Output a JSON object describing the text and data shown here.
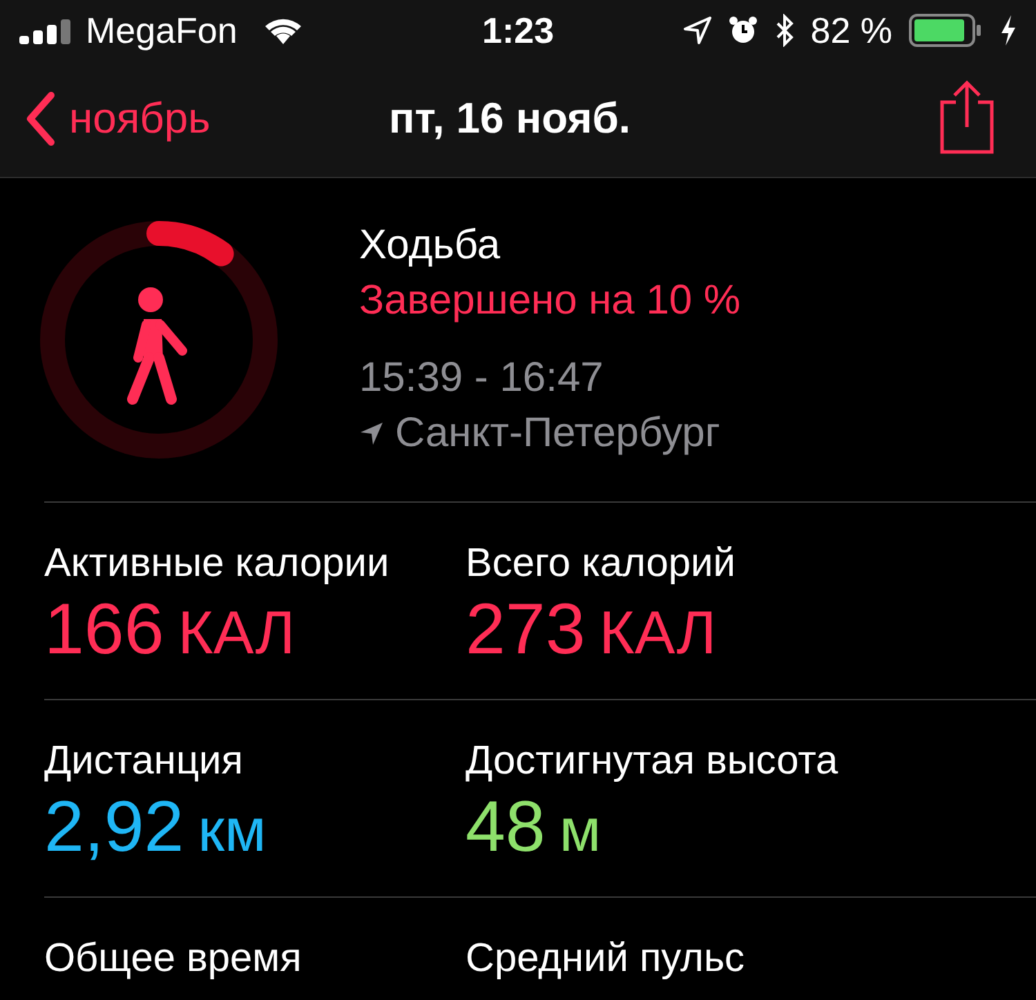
{
  "status_bar": {
    "carrier": "MegaFon",
    "time": "1:23",
    "battery": "82 %"
  },
  "nav": {
    "back": "ноябрь",
    "title": "пт, 16 нояб."
  },
  "workout": {
    "title": "Ходьба",
    "completion": "Завершено на 10 %",
    "time_range": "15:39 - 16:47",
    "location": "Санкт-Петербург",
    "ring": {
      "level": 0.1
    }
  },
  "metrics": [
    [
      {
        "label": "Активные калории",
        "value": "166",
        "unit": "КАЛ",
        "color": "#ff2d55"
      },
      {
        "label": "Всего калорий",
        "value": "273",
        "unit": "КАЛ",
        "color": "#ff2d55"
      }
    ],
    [
      {
        "label": "Дистанция",
        "value": "2,92",
        "unit": "км",
        "color": "#1fb6f5"
      },
      {
        "label": "Достигнутая высота",
        "value": "48",
        "unit": "м",
        "color": "#8ee06b"
      }
    ],
    [
      {
        "label": "Общее время"
      },
      {
        "label": "Средний пульс"
      }
    ]
  ]
}
